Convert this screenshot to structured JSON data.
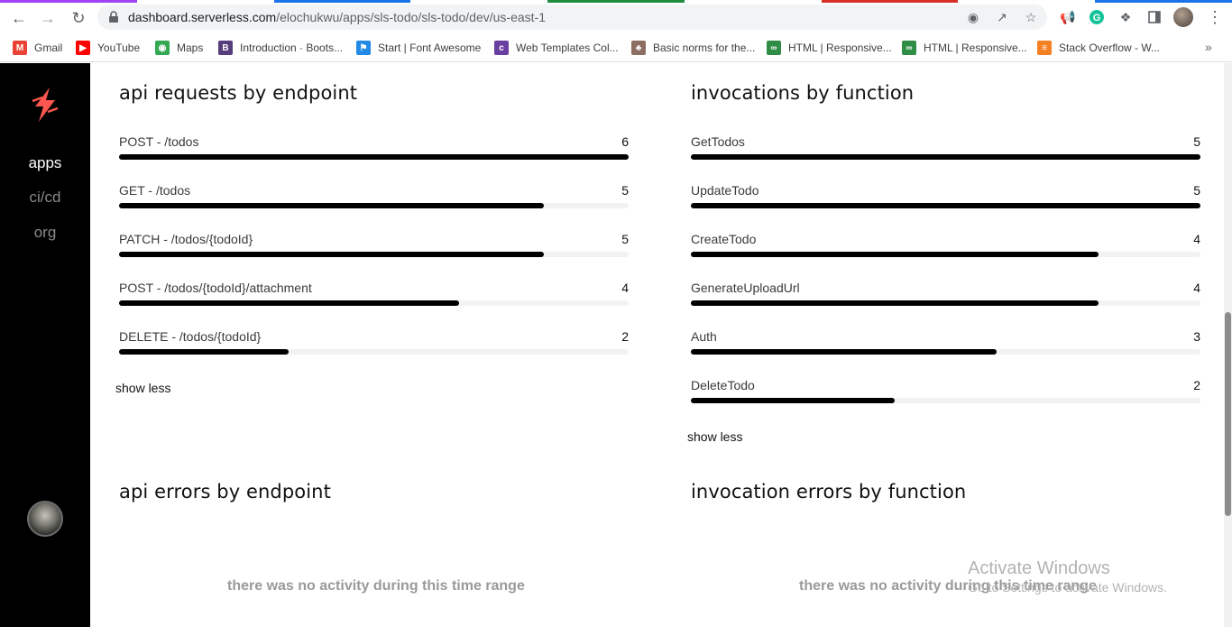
{
  "browser": {
    "url_host": "dashboard.serverless.com",
    "url_path": "/elochukwu/apps/sls-todo/sls-todo/dev/us-east-1",
    "bookmarks": [
      {
        "label": "Gmail",
        "icon": "gmail-icon",
        "color": "#ea4335"
      },
      {
        "label": "YouTube",
        "icon": "youtube-icon",
        "color": "#ff0000"
      },
      {
        "label": "Maps",
        "icon": "maps-icon",
        "color": "#34a853"
      },
      {
        "label": "Introduction · Boots...",
        "icon": "bootstrap-icon",
        "color": "#563d7c"
      },
      {
        "label": "Start | Font Awesome",
        "icon": "font-awesome-icon",
        "color": "#228ae6"
      },
      {
        "label": "Web Templates Col...",
        "icon": "colorlib-icon",
        "color": "#6b3fa0"
      },
      {
        "label": "Basic norms for the...",
        "icon": "tree-icon",
        "color": "#8d6e63"
      },
      {
        "label": "HTML | Responsive...",
        "icon": "gfg-icon",
        "color": "#2f8d46"
      },
      {
        "label": "HTML | Responsive...",
        "icon": "gfg-icon",
        "color": "#2f8d46"
      },
      {
        "label": "Stack Overflow - W...",
        "icon": "stackoverflow-icon",
        "color": "#f48024"
      }
    ]
  },
  "sidebar": {
    "items": [
      {
        "label": "apps",
        "active": true
      },
      {
        "label": "ci/cd",
        "active": false
      },
      {
        "label": "org",
        "active": false
      }
    ]
  },
  "api_requests": {
    "title": "api requests by endpoint",
    "max": 6,
    "rows": [
      {
        "label": "POST - /todos",
        "count": "6",
        "value": 6
      },
      {
        "label": "GET - /todos",
        "count": "5",
        "value": 5
      },
      {
        "label": "PATCH - /todos/{todoId}",
        "count": "5",
        "value": 5
      },
      {
        "label": "POST - /todos/{todoId}/attachment",
        "count": "4",
        "value": 4
      },
      {
        "label": "DELETE - /todos/{todoId}",
        "count": "2",
        "value": 2
      }
    ],
    "show_less": "show less"
  },
  "invocations": {
    "title": "invocations by function",
    "max": 5,
    "rows": [
      {
        "label": "GetTodos",
        "count": "5",
        "value": 5
      },
      {
        "label": "UpdateTodo",
        "count": "5",
        "value": 5
      },
      {
        "label": "CreateTodo",
        "count": "4",
        "value": 4
      },
      {
        "label": "GenerateUploadUrl",
        "count": "4",
        "value": 4
      },
      {
        "label": "Auth",
        "count": "3",
        "value": 3
      },
      {
        "label": "DeleteTodo",
        "count": "2",
        "value": 2
      }
    ],
    "show_less": "show less"
  },
  "api_errors": {
    "title": "api errors by endpoint",
    "empty": "there was no activity during this time range"
  },
  "invocation_errors": {
    "title": "invocation errors by function",
    "empty": "there was no activity during this time range"
  },
  "watermark": {
    "line1": "Activate Windows",
    "line2": "Go to Settings to activate Windows."
  }
}
